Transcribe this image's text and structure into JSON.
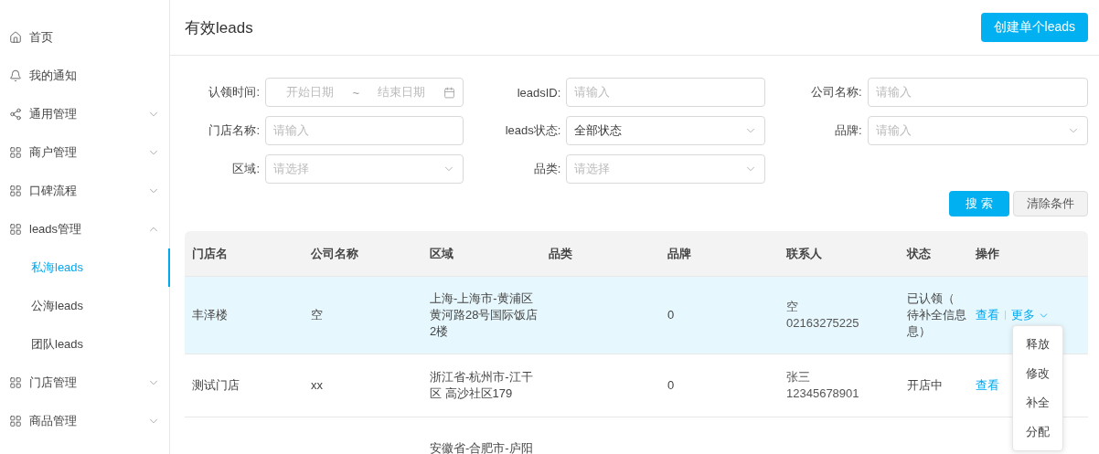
{
  "sidebar": {
    "items": [
      {
        "label": "首页",
        "kind": "home",
        "selected": false
      },
      {
        "label": "我的通知",
        "kind": "bell",
        "selected": false
      },
      {
        "label": "通用管理",
        "kind": "share",
        "selected": false,
        "expanded": false
      },
      {
        "label": "商户管理",
        "kind": "grid",
        "selected": false,
        "expanded": false
      },
      {
        "label": "口碑流程",
        "kind": "grid",
        "selected": false,
        "expanded": false
      },
      {
        "label": "leads管理",
        "kind": "grid",
        "selected": false,
        "expanded": true,
        "children": [
          {
            "label": "私海leads",
            "selected": true
          },
          {
            "label": "公海leads",
            "selected": false
          },
          {
            "label": "团队leads",
            "selected": false
          }
        ]
      },
      {
        "label": "门店管理",
        "kind": "grid",
        "selected": false,
        "expanded": false
      },
      {
        "label": "商品管理",
        "kind": "grid",
        "selected": false,
        "expanded": false
      }
    ]
  },
  "header": {
    "title": "有效leads",
    "create_button": "创建单个leads"
  },
  "filters": [
    {
      "label": "认领时间:",
      "kind": "daterange",
      "start_placeholder": "开始日期",
      "separator": "~",
      "end_placeholder": "结束日期"
    },
    {
      "label": "leadsID:",
      "kind": "input",
      "placeholder": "请输入"
    },
    {
      "label": "公司名称:",
      "kind": "input",
      "placeholder": "请输入"
    },
    {
      "label": "门店名称:",
      "kind": "input",
      "placeholder": "请输入"
    },
    {
      "label": "leads状态:",
      "kind": "select",
      "value": "全部状态"
    },
    {
      "label": "品牌:",
      "kind": "select",
      "placeholder": "请输入"
    },
    {
      "label": "区域:",
      "kind": "select",
      "placeholder": "请选择"
    },
    {
      "label": "品类:",
      "kind": "select",
      "placeholder": "请选择"
    }
  ],
  "search_button": "搜 索",
  "clear_button": "清除条件",
  "table": {
    "columns": [
      "门店名",
      "公司名称",
      "区域",
      "品类",
      "品牌",
      "联系人",
      "状态",
      "操作"
    ],
    "rows": [
      {
        "highlighted": true,
        "store": "丰泽楼",
        "company": "空",
        "region": [
          "上海-上海市-黄浦区",
          "黄河路28号国际饭店",
          "2楼"
        ],
        "brand": "0",
        "contact": {
          "name": "空",
          "phone": "02163275225"
        },
        "status": [
          "已认领（",
          "待补全信息",
          "息）"
        ],
        "view": "查看",
        "more": {
          "label": "更多",
          "open": true,
          "menu": [
            "释放",
            "修改",
            "补全",
            "分配"
          ]
        }
      },
      {
        "highlighted": false,
        "store": "测试门店",
        "company": "xx",
        "region": [
          "浙江省-杭州市-江干",
          "区 高沙社区179"
        ],
        "brand": "0",
        "contact": {
          "name": "张三",
          "phone": "12345678901"
        },
        "status": [
          "开店中"
        ],
        "view": "查看"
      },
      {
        "highlighted": false,
        "region": [
          "安徽省-合肥市-庐阳"
        ]
      }
    ]
  }
}
